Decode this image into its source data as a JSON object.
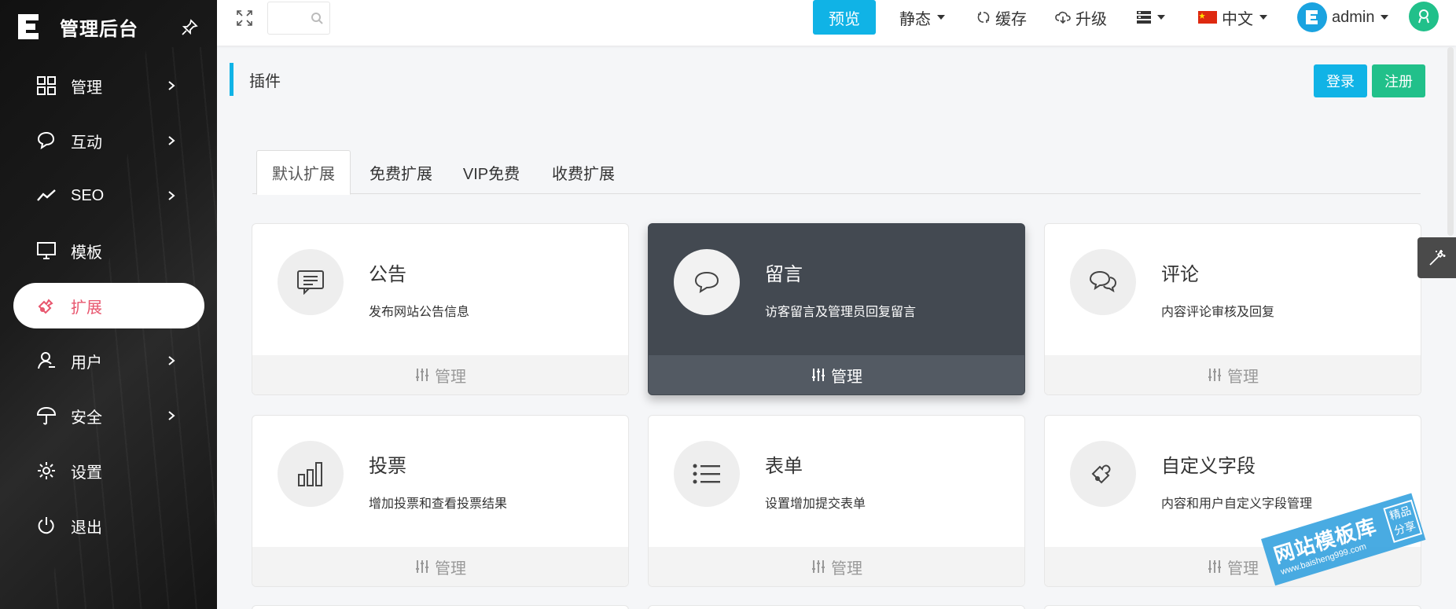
{
  "sidebar": {
    "brand_title": "管理后台",
    "items": [
      {
        "label": "管理",
        "icon": "grid-icon",
        "has_arrow": true
      },
      {
        "label": "互动",
        "icon": "chat-icon",
        "has_arrow": true
      },
      {
        "label": "SEO",
        "icon": "trend-icon",
        "has_arrow": true
      },
      {
        "label": "模板",
        "icon": "monitor-icon",
        "has_arrow": false
      },
      {
        "label": "扩展",
        "icon": "plug-icon",
        "has_arrow": false,
        "active": true
      },
      {
        "label": "用户",
        "icon": "user-icon",
        "has_arrow": true
      },
      {
        "label": "安全",
        "icon": "umbrella-icon",
        "has_arrow": true
      },
      {
        "label": "设置",
        "icon": "gear-icon",
        "has_arrow": false
      },
      {
        "label": "退出",
        "icon": "power-icon",
        "has_arrow": false
      }
    ]
  },
  "topbar": {
    "search_placeholder": "",
    "preview_label": "预览",
    "static_label": "静态",
    "cache_label": "缓存",
    "upgrade_label": "升级",
    "language_label": "中文",
    "user_name": "admin"
  },
  "page": {
    "title": "插件",
    "login_label": "登录",
    "register_label": "注册"
  },
  "tabs": [
    {
      "label": "默认扩展",
      "active": true
    },
    {
      "label": "免费扩展",
      "active": false
    },
    {
      "label": "VIP免费",
      "active": false
    },
    {
      "label": "收费扩展",
      "active": false
    }
  ],
  "cards": [
    {
      "title": "公告",
      "desc": "发布网站公告信息",
      "icon": "notice-icon",
      "action": "管理"
    },
    {
      "title": "留言",
      "desc": "访客留言及管理员回复留言",
      "icon": "message-icon",
      "action": "管理",
      "hover": true
    },
    {
      "title": "评论",
      "desc": "内容评论审核及回复",
      "icon": "comments-icon",
      "action": "管理"
    },
    {
      "title": "投票",
      "desc": "增加投票和查看投票结果",
      "icon": "bar-chart-icon",
      "action": "管理"
    },
    {
      "title": "表单",
      "desc": "设置增加提交表单",
      "icon": "list-icon",
      "action": "管理"
    },
    {
      "title": "自定义字段",
      "desc": "内容和用户自定义字段管理",
      "icon": "puzzle-icon",
      "action": "管理"
    }
  ],
  "watermark": {
    "main": "网站模板库",
    "badge": "精品分享",
    "url": "www.baisheng999.com"
  },
  "colors": {
    "accent": "#10b3e6",
    "success": "#21c08a",
    "active_menu": "#e8566e",
    "hover_card": "#434951"
  }
}
